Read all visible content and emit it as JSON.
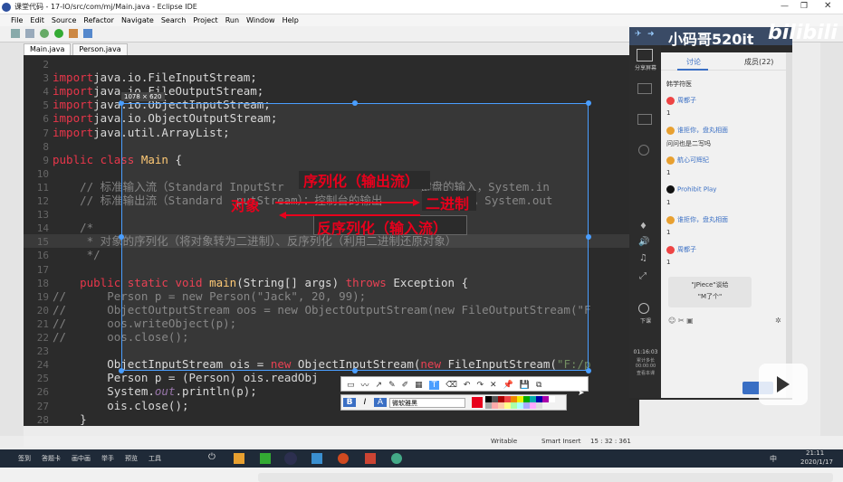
{
  "window": {
    "title": "课堂代码 - 17-IO/src/com/mj/Main.java - Eclipse IDE"
  },
  "menu": [
    "File",
    "Edit",
    "Source",
    "Refactor",
    "Navigate",
    "Search",
    "Project",
    "Run",
    "Window",
    "Help"
  ],
  "tabs": [
    {
      "label": "Main.java"
    },
    {
      "label": "Person.java"
    }
  ],
  "code": [
    {
      "n": "2",
      "html": ""
    },
    {
      "n": "3",
      "t": [
        [
          "red",
          "import"
        ],
        [
          "",
          "java.io.FileInputStream;"
        ]
      ]
    },
    {
      "n": "4",
      "t": [
        [
          "red",
          "import"
        ],
        [
          "",
          "java.io.FileOutputStream;"
        ]
      ]
    },
    {
      "n": "5",
      "t": [
        [
          "red",
          "import"
        ],
        [
          "",
          "java.io.ObjectInputStream;"
        ]
      ]
    },
    {
      "n": "6",
      "t": [
        [
          "red",
          "import"
        ],
        [
          "",
          "java.io.ObjectOutputStream;"
        ]
      ]
    },
    {
      "n": "7",
      "t": [
        [
          "red",
          "import"
        ],
        [
          "",
          "java.util.ArrayList;"
        ]
      ]
    },
    {
      "n": "8",
      "t": []
    },
    {
      "n": "9",
      "t": [
        [
          "red",
          "public class"
        ],
        [
          "cls",
          " Main"
        ],
        [
          "",
          " {"
        ]
      ]
    },
    {
      "n": "10",
      "t": []
    },
    {
      "n": "11",
      "t": [
        [
          "cm",
          "    // 标准输入流（Standard InputStr"
        ],
        [
          "cm",
          "                    键盘的输入，System.in"
        ]
      ]
    },
    {
      "n": "12",
      "t": [
        [
          "cm",
          "    // 标准输出流（Standard  putStream）：控制台的输出          输出，System.out"
        ]
      ]
    },
    {
      "n": "13",
      "t": []
    },
    {
      "n": "14",
      "t": [
        [
          "cm",
          "    /*"
        ]
      ]
    },
    {
      "n": "15",
      "t": [
        [
          "cm",
          "     * 对象的序列化（将对象转为二进制）、反序列化（利用二进制还原对象）"
        ]
      ],
      "hl": true
    },
    {
      "n": "16",
      "t": [
        [
          "cm",
          "     */"
        ]
      ]
    },
    {
      "n": "17",
      "t": []
    },
    {
      "n": "18",
      "t": [
        [
          "red",
          "    public static void"
        ],
        [
          "cls",
          " main"
        ],
        [
          "",
          "(String[] args) "
        ],
        [
          "red",
          "throws"
        ],
        [
          "",
          " Exception {"
        ]
      ]
    },
    {
      "n": "19",
      "t": [
        [
          "cm",
          "//      Person p = new Person(\"Jack\", 20, 99);"
        ]
      ]
    },
    {
      "n": "20",
      "t": [
        [
          "cm",
          "//      ObjectOutputStream oos = new ObjectOutputStream(new FileOutputStream(\"F"
        ]
      ]
    },
    {
      "n": "21",
      "t": [
        [
          "cm",
          "//      oos.writeObject(p);"
        ]
      ]
    },
    {
      "n": "22",
      "t": [
        [
          "cm",
          "//      oos.close();"
        ]
      ]
    },
    {
      "n": "23",
      "t": []
    },
    {
      "n": "24",
      "t": [
        [
          "",
          "        ObjectInputStream ois = "
        ],
        [
          "red",
          "new"
        ],
        [
          "",
          " ObjectInputStream("
        ],
        [
          "red",
          "new"
        ],
        [
          "",
          " FileInputStream("
        ],
        [
          "str",
          "\"F:/p"
        ]
      ]
    },
    {
      "n": "25",
      "t": [
        [
          "",
          "        Person p = (Person) ois.readObj"
        ]
      ]
    },
    {
      "n": "26",
      "t": [
        [
          "",
          "        System."
        ],
        [
          "it",
          "out"
        ],
        [
          "",
          ".println(p);"
        ]
      ]
    },
    {
      "n": "27",
      "t": [
        [
          "",
          "        ois.close();"
        ]
      ]
    },
    {
      "n": "28",
      "t": [
        [
          "",
          "    }"
        ]
      ]
    }
  ],
  "annotations": {
    "serialize": "序列化（输出流）",
    "object": "对象",
    "binary": "二进制",
    "deserialize": "反序列化（输入流）"
  },
  "selection": {
    "size_label": "1078 × 620"
  },
  "sidebar": {
    "brand": "小码哥520it",
    "logo": "bilibili",
    "tabs": [
      "讨论",
      "成员(22)"
    ],
    "icon_labels": [
      "分享屏幕",
      "",
      "",
      "",
      "",
      "",
      "",
      "",
      "下课"
    ],
    "chat": [
      {
        "text": "韩学符医"
      },
      {
        "name": "周都子",
        "msg": "1"
      },
      {
        "name": "谁拒你，盘丸相面",
        "msg": "问问也是二写吗"
      },
      {
        "name": "航心可辉纪",
        "msg": "1"
      },
      {
        "name": "Prohibit Play",
        "msg": "1"
      },
      {
        "name": "谁拒你，盘丸相面",
        "msg": "1"
      },
      {
        "name": "周都子",
        "msg": "1"
      }
    ],
    "input_lines": [
      "\"JPiece\"谈给",
      "\"M了个\""
    ],
    "timer": "01:16:03",
    "timer_sub": "累计多长",
    "timer_sub2": "00:00:00",
    "timer_sub3": "查看本课"
  },
  "draw_font": "微软雅黑",
  "status": {
    "writable": "Writable",
    "insert": "Smart Insert",
    "pos": "15 : 32 : 361"
  },
  "taskbar": {
    "items": [
      "签到",
      "答题卡",
      "画中画",
      "举手",
      "预览",
      "工具"
    ],
    "time": "21:11",
    "date": "2020/1/17",
    "ime": "中"
  },
  "colors": {
    "accent": "#4a9eff",
    "annot": "#e8001c",
    "editor_bg": "#2b2b2b"
  }
}
